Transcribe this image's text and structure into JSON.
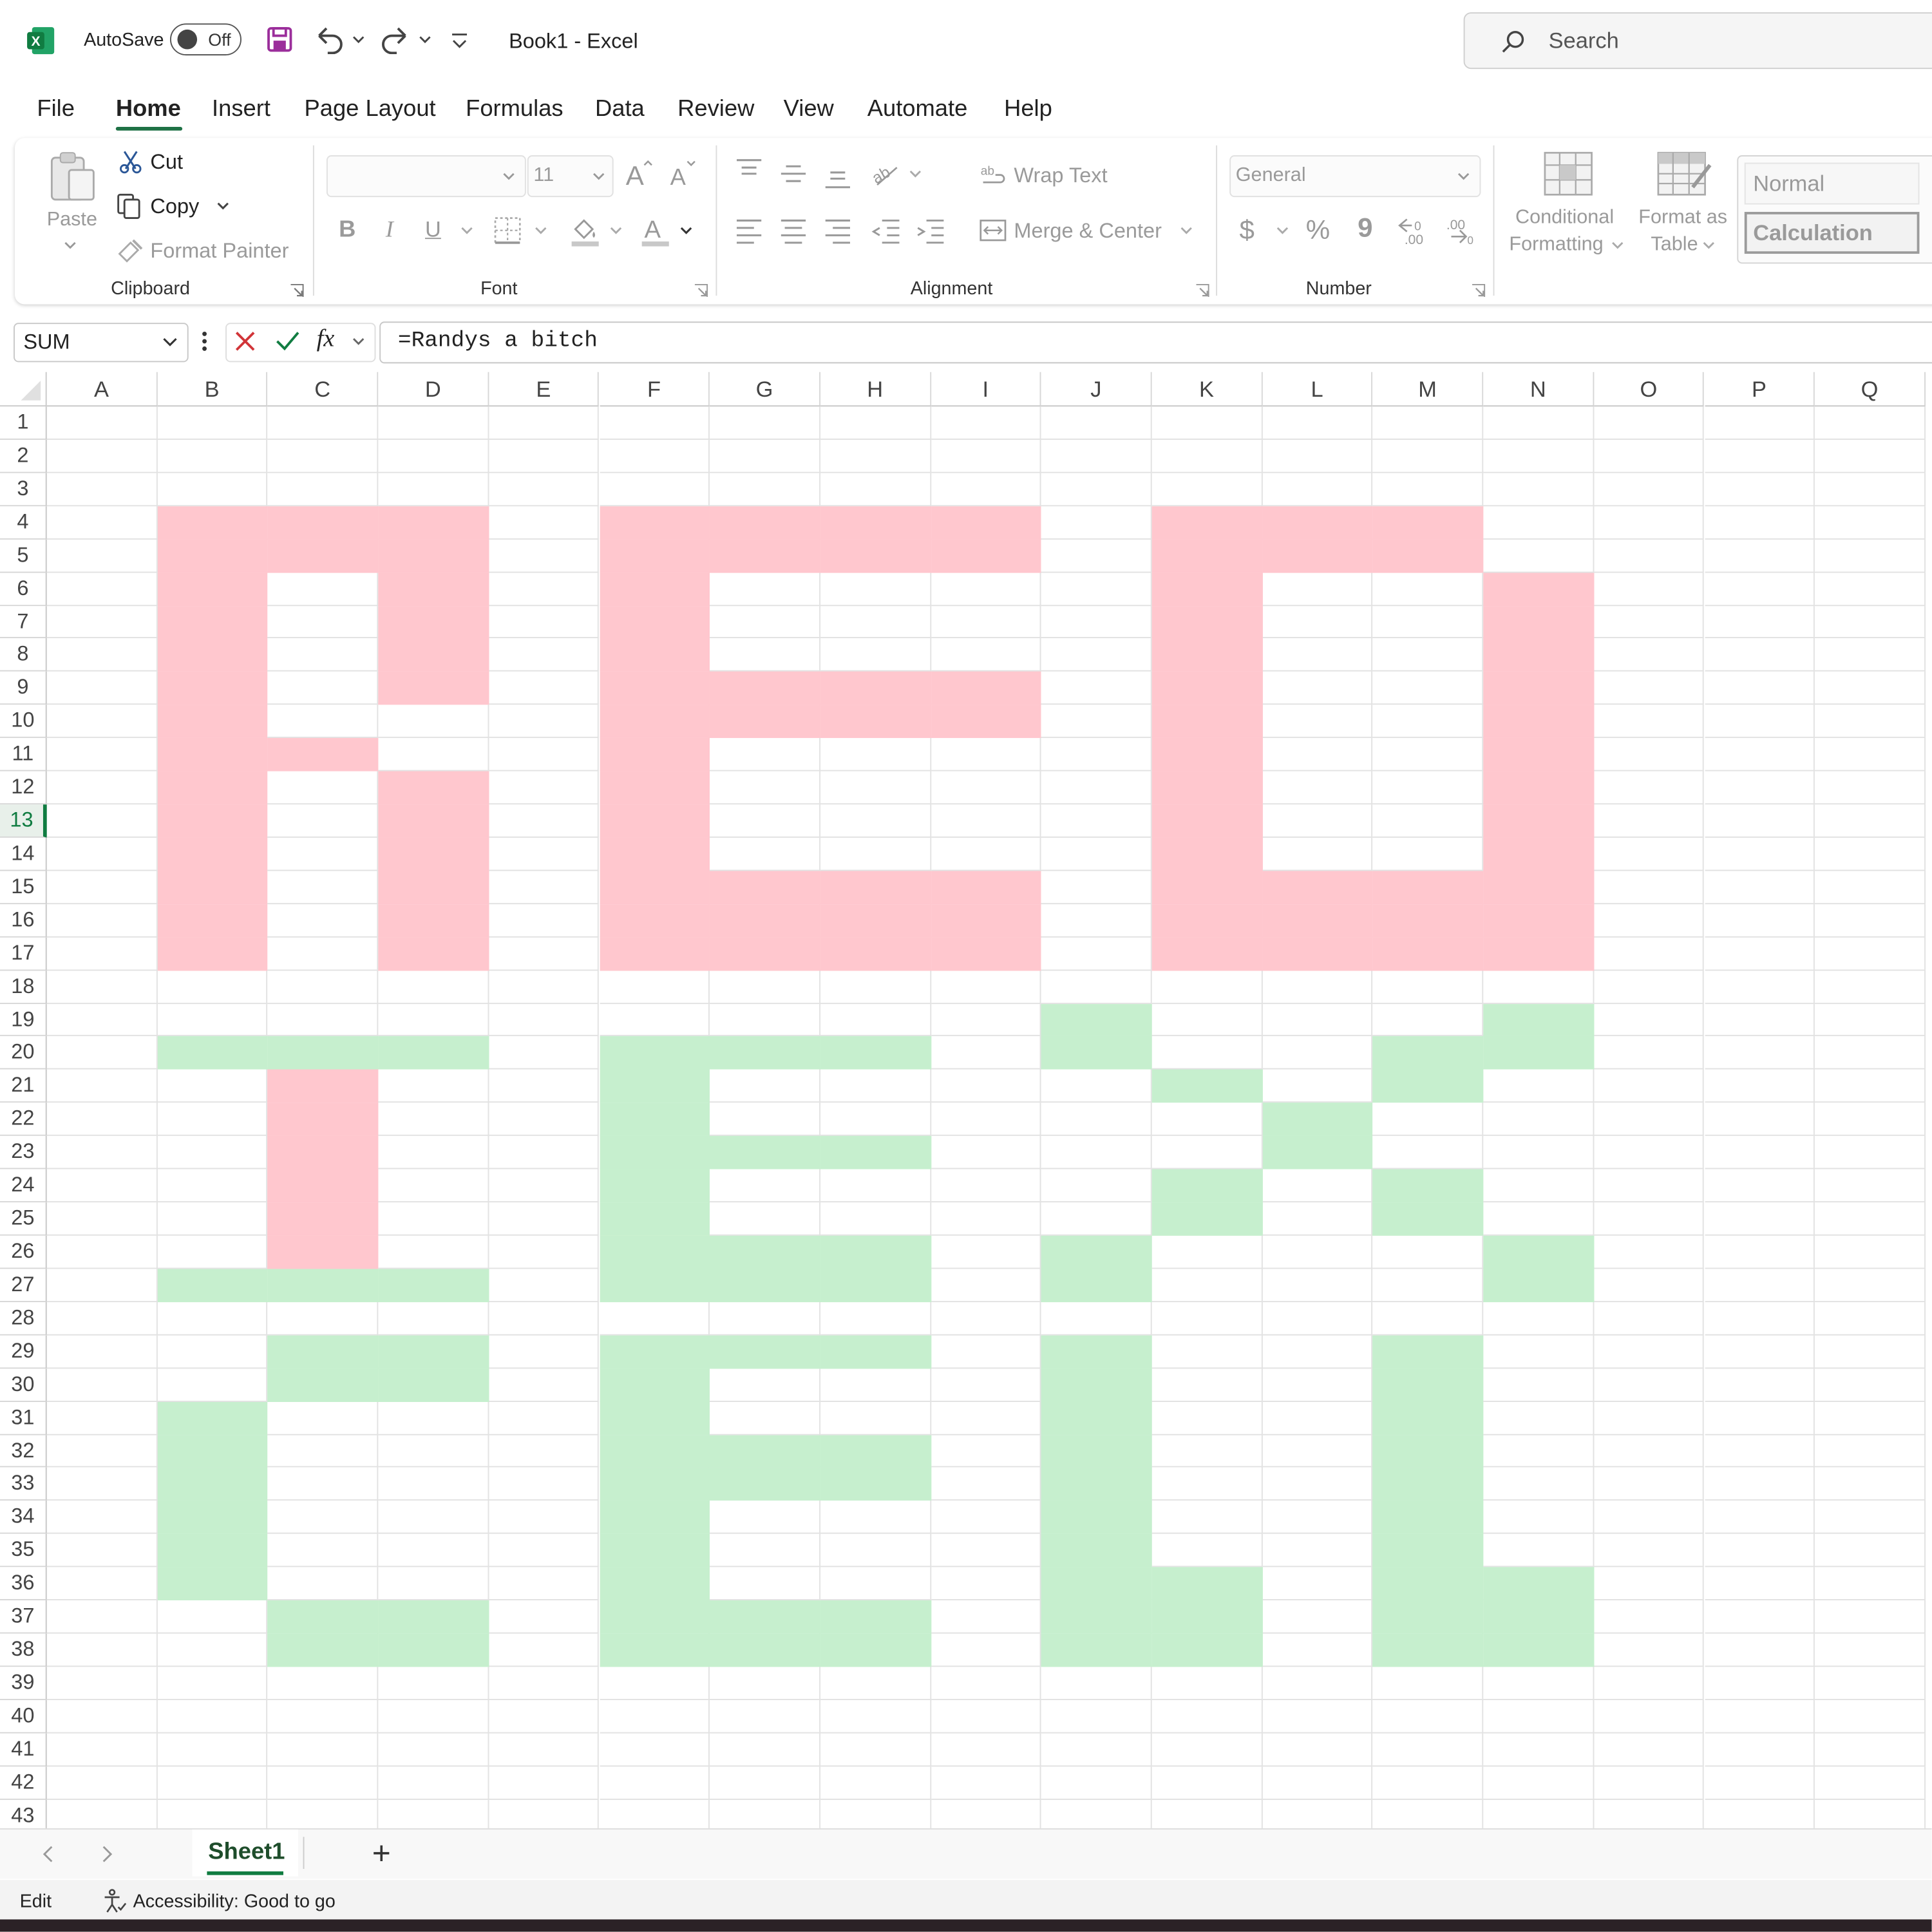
{
  "titlebar": {
    "autosave_label": "AutoSave",
    "autosave_state": "Off",
    "document_title": "Book1  -  Excel",
    "search_placeholder": "Search"
  },
  "menu": {
    "items": [
      "File",
      "Home",
      "Insert",
      "Page Layout",
      "Formulas",
      "Data",
      "Review",
      "View",
      "Automate",
      "Help"
    ],
    "active": "Home"
  },
  "ribbon": {
    "clipboard": {
      "group_label": "Clipboard",
      "paste_label": "Paste",
      "cut_label": "Cut",
      "copy_label": "Copy",
      "format_painter_label": "Format Painter"
    },
    "font": {
      "group_label": "Font",
      "font_name": "",
      "font_size": "11",
      "bold": "B",
      "italic": "I",
      "underline": "U"
    },
    "alignment": {
      "group_label": "Alignment",
      "wrap_text_label": "Wrap Text",
      "merge_center_label": "Merge & Center"
    },
    "number": {
      "group_label": "Number",
      "format": "General",
      "currency": "$",
      "percent": "%",
      "comma": "9",
      "inc_decimal": "⇤.00",
      "dec_decimal": ".00"
    },
    "styles": {
      "conditional_formatting_line1": "Conditional",
      "conditional_formatting_line2": "Formatting",
      "format_as_table_line1": "Format as",
      "format_as_table_line2": "Table",
      "style_normal": "Normal",
      "style_calculation": "Calculation"
    }
  },
  "formula_bar": {
    "name_box": "SUM",
    "fx": "fx",
    "formula": "=Randys a bitch"
  },
  "sheet": {
    "columns": [
      "A",
      "B",
      "C",
      "D",
      "E",
      "F",
      "G",
      "H",
      "I",
      "J",
      "K",
      "L",
      "M",
      "N",
      "O",
      "P",
      "Q"
    ],
    "rows": [
      "1",
      "2",
      "3",
      "4",
      "5",
      "6",
      "7",
      "8",
      "9",
      "10",
      "11",
      "12",
      "13",
      "14",
      "15",
      "16",
      "17",
      "18",
      "19",
      "20",
      "21",
      "22",
      "23",
      "24",
      "25",
      "26",
      "27",
      "28",
      "29",
      "30",
      "31",
      "32",
      "33",
      "34",
      "35",
      "36",
      "37",
      "38",
      "39",
      "40",
      "41",
      "42",
      "43"
    ],
    "active_row": "13",
    "fill_colors": {
      "pink": "#ffc7ce",
      "green": "#c6efce"
    },
    "pink_cells": [
      "B4",
      "C4",
      "D4",
      "F4",
      "G4",
      "H4",
      "I4",
      "K4",
      "L4",
      "M4",
      "B5",
      "C5",
      "D5",
      "F5",
      "G5",
      "H5",
      "I5",
      "K5",
      "L5",
      "M5",
      "B6",
      "D6",
      "F6",
      "K6",
      "N6",
      "B7",
      "D7",
      "F7",
      "K7",
      "N7",
      "B8",
      "D8",
      "F8",
      "K8",
      "N8",
      "B9",
      "D9",
      "F9",
      "G9",
      "H9",
      "I9",
      "K9",
      "N9",
      "B10",
      "F10",
      "G10",
      "H10",
      "I10",
      "K10",
      "N10",
      "B11",
      "C11",
      "F11",
      "K11",
      "N11",
      "B12",
      "D12",
      "F12",
      "K12",
      "N12",
      "B13",
      "D13",
      "F13",
      "K13",
      "N13",
      "B14",
      "D14",
      "F14",
      "K14",
      "N14",
      "B15",
      "D15",
      "F15",
      "G15",
      "H15",
      "I15",
      "K15",
      "L15",
      "M15",
      "N15",
      "B16",
      "D16",
      "F16",
      "G16",
      "H16",
      "I16",
      "K16",
      "L16",
      "M16",
      "N16",
      "B17",
      "D17",
      "F17",
      "G17",
      "H17",
      "I17",
      "K17",
      "L17",
      "M17",
      "N17",
      "C21",
      "C22",
      "C23",
      "C24",
      "C25",
      "C26"
    ],
    "green_cells": [
      "J19",
      "N19",
      "B20",
      "C20",
      "D20",
      "F20",
      "G20",
      "H20",
      "J20",
      "M20",
      "N20",
      "F21",
      "K21",
      "M21",
      "F22",
      "L22",
      "F23",
      "G23",
      "H23",
      "L23",
      "F24",
      "K24",
      "M24",
      "F25",
      "K25",
      "M25",
      "F26",
      "G26",
      "H26",
      "J26",
      "N26",
      "B27",
      "C27",
      "D27",
      "F27",
      "G27",
      "H27",
      "J27",
      "N27",
      "C29",
      "D29",
      "F29",
      "G29",
      "H29",
      "J29",
      "M29",
      "C30",
      "D30",
      "F30",
      "J30",
      "M30",
      "B31",
      "F31",
      "J31",
      "M31",
      "B32",
      "F32",
      "G32",
      "H32",
      "J32",
      "M32",
      "B33",
      "F33",
      "G33",
      "H33",
      "J33",
      "M33",
      "B34",
      "F34",
      "J34",
      "M34",
      "B35",
      "F35",
      "J35",
      "M35",
      "B36",
      "F36",
      "J36",
      "K36",
      "M36",
      "N36",
      "C37",
      "D37",
      "F37",
      "G37",
      "H37",
      "J37",
      "K37",
      "M37",
      "N37",
      "C38",
      "D38",
      "F38",
      "G38",
      "H38",
      "J38",
      "K38",
      "M38",
      "N38"
    ]
  },
  "sheet_tabs": {
    "active_tab": "Sheet1",
    "add_label": "+"
  },
  "status_bar": {
    "mode": "Edit",
    "accessibility": "Accessibility: Good to go"
  }
}
